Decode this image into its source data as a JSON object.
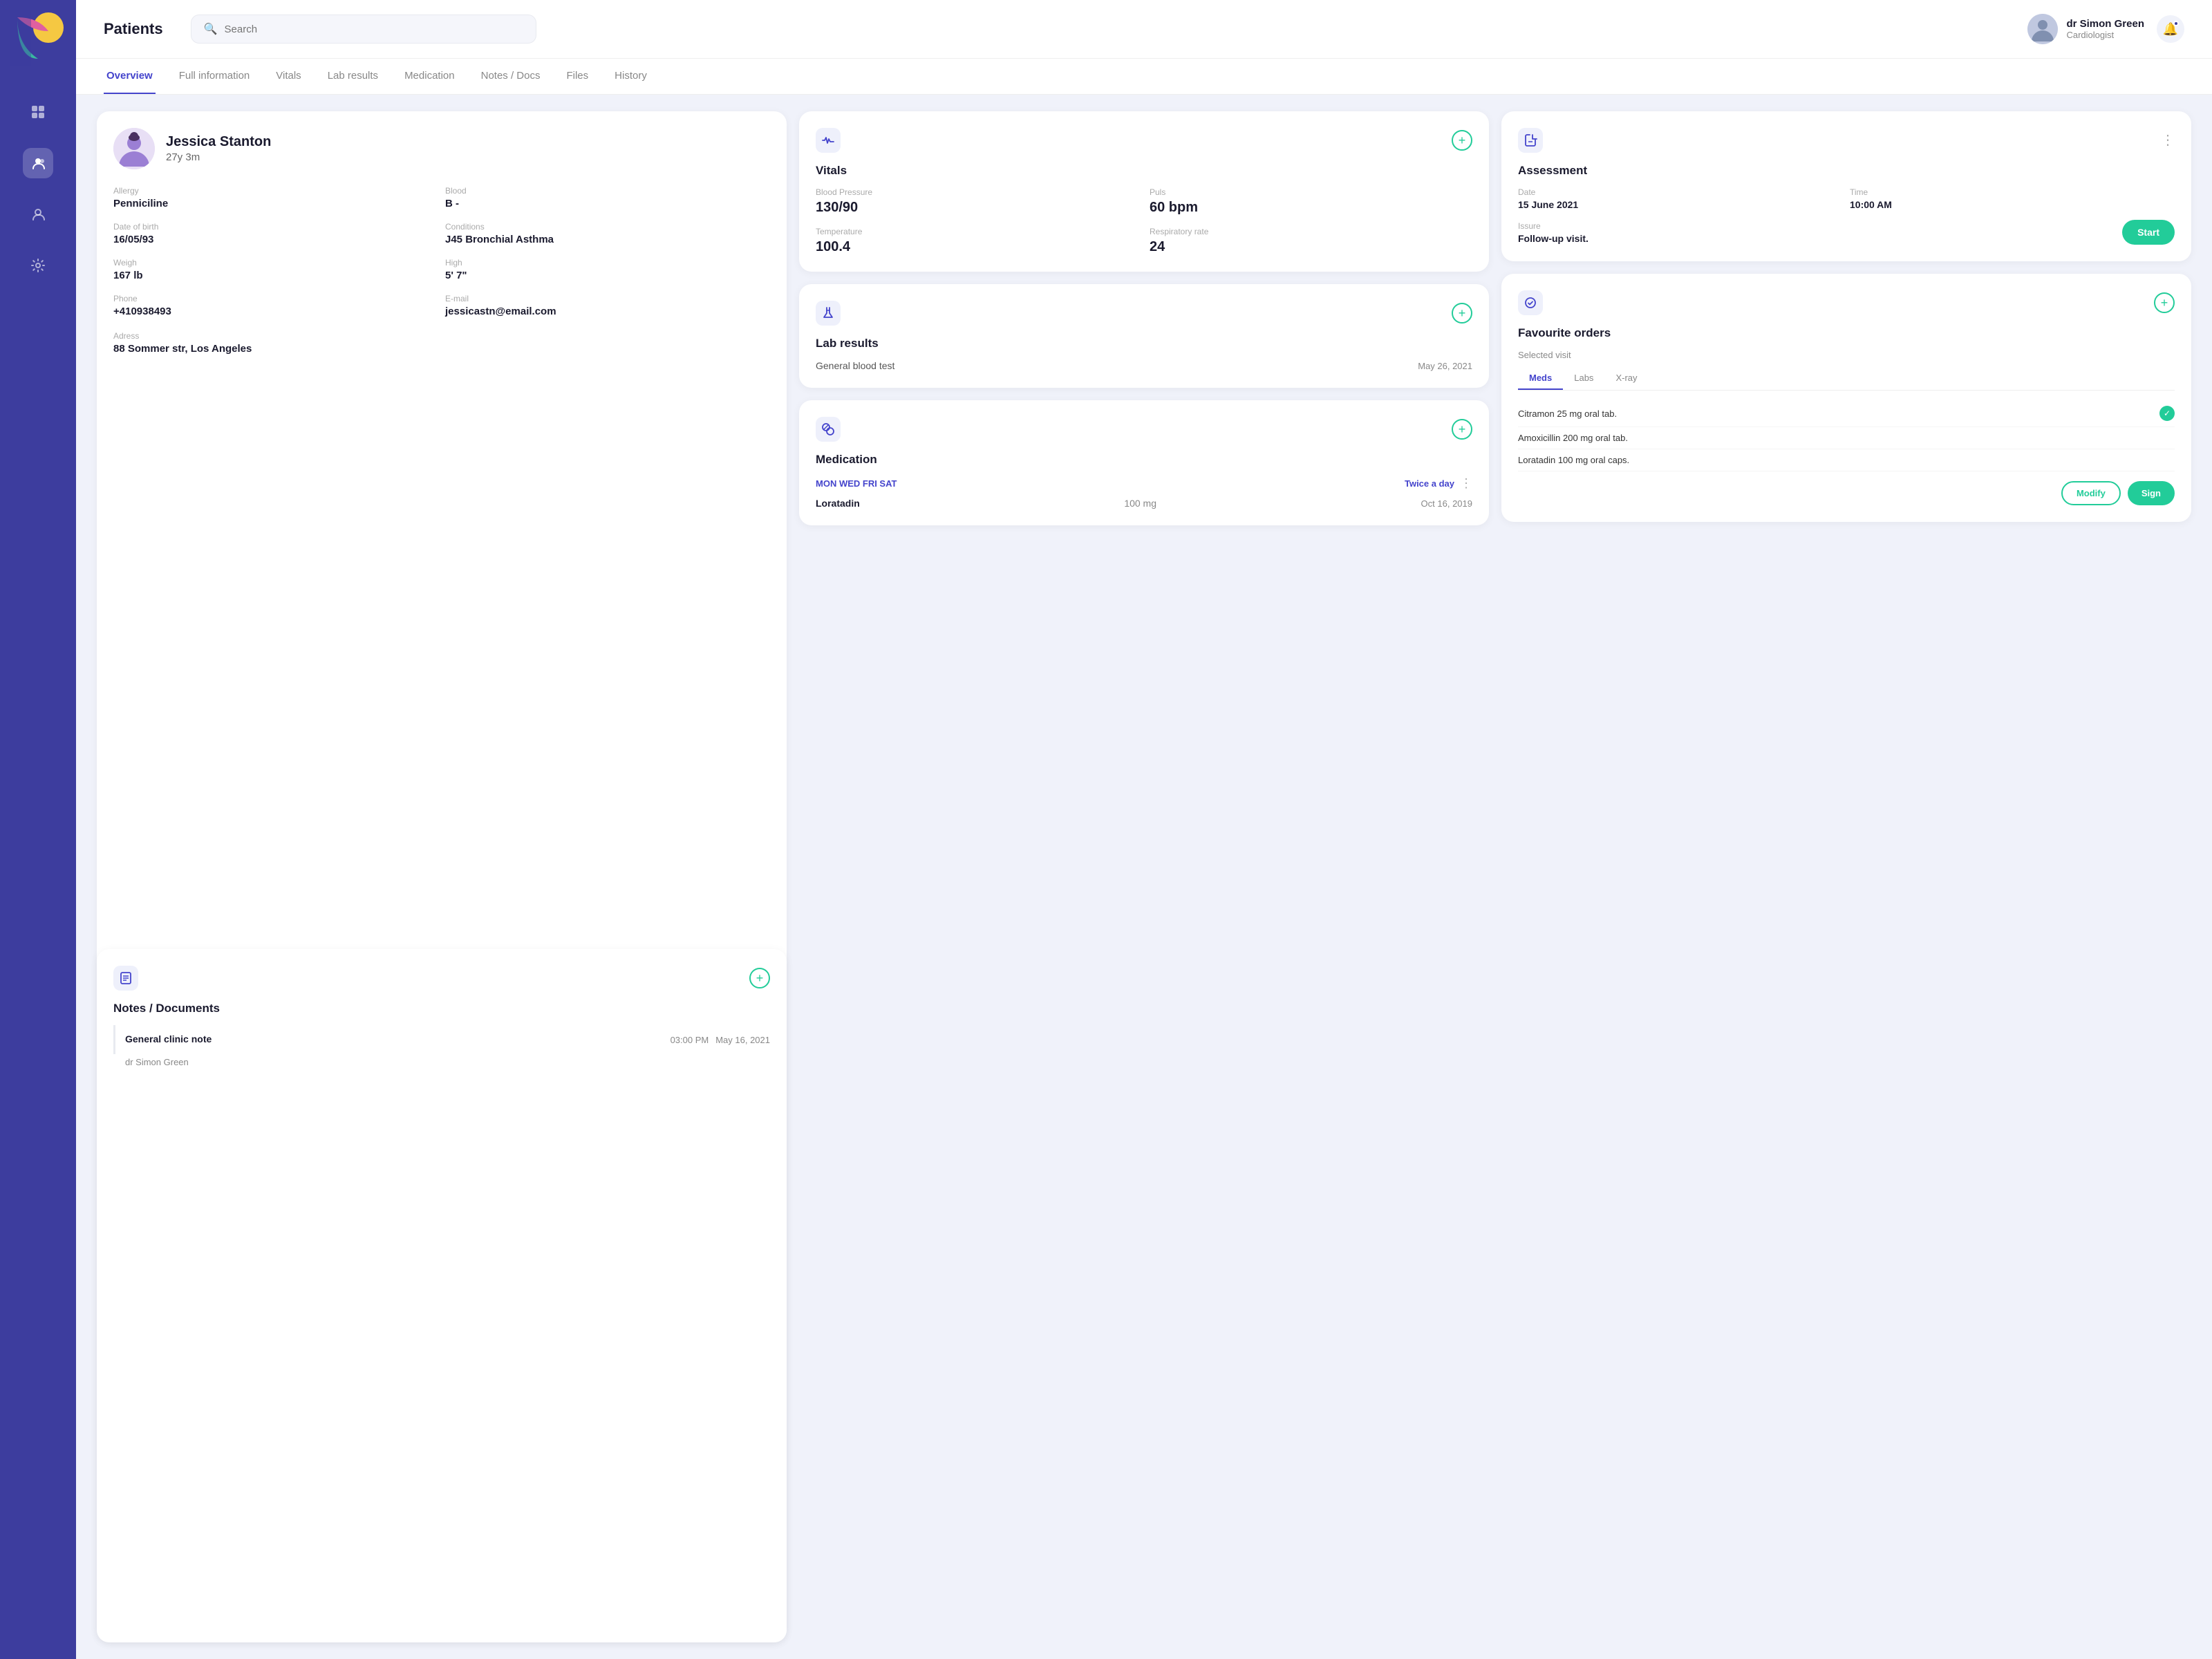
{
  "app": {
    "title": "Patients"
  },
  "header": {
    "search_placeholder": "Search",
    "doctor_name": "dr Simon Green",
    "doctor_role": "Cardiologist"
  },
  "tabs": [
    {
      "id": "overview",
      "label": "Overview",
      "active": true
    },
    {
      "id": "full-info",
      "label": "Full information",
      "active": false
    },
    {
      "id": "vitals",
      "label": "Vitals",
      "active": false
    },
    {
      "id": "lab-results",
      "label": "Lab results",
      "active": false
    },
    {
      "id": "medication",
      "label": "Medication",
      "active": false
    },
    {
      "id": "notes-docs",
      "label": "Notes / Docs",
      "active": false
    },
    {
      "id": "files",
      "label": "Files",
      "active": false
    },
    {
      "id": "history",
      "label": "History",
      "active": false
    }
  ],
  "patient": {
    "name": "Jessica Stanton",
    "age": "27y 3m",
    "allergy_label": "Allergy",
    "allergy": "Penniciline",
    "blood_label": "Blood",
    "blood": "B -",
    "dob_label": "Date of birth",
    "dob": "16/05/93",
    "conditions_label": "Conditions",
    "conditions": "J45 Bronchial Asthma",
    "weight_label": "Weigh",
    "weight": "167 lb",
    "height_label": "High",
    "height": "5' 7\"",
    "phone_label": "Phone",
    "phone": "+410938493",
    "email_label": "E-mail",
    "email": "jessicastn@email.com",
    "address_label": "Adress",
    "address": "88 Sommer str, Los Angeles"
  },
  "vitals": {
    "title": "Vitals",
    "bp_label": "Blood Pressure",
    "bp": "130/90",
    "puls_label": "Puls",
    "puls": "60 bpm",
    "temp_label": "Temperature",
    "temp": "100.4",
    "resp_label": "Respiratory rate",
    "resp": "24"
  },
  "assessment": {
    "title": "Assessment",
    "date_label": "Date",
    "date": "15 June 2021",
    "time_label": "Time",
    "time": "10:00 AM",
    "issue_label": "Issure",
    "issue": "Follow-up visit.",
    "start_btn": "Start"
  },
  "notes": {
    "title": "Notes / Documents",
    "entry_title": "General clinic note",
    "entry_time": "03:00 PM",
    "entry_date": "May 16, 2021",
    "entry_doctor": "dr Simon Green"
  },
  "lab": {
    "title": "Lab results",
    "entry_name": "General blood test",
    "entry_date": "May 26, 2021"
  },
  "medication": {
    "title": "Medication",
    "days": "MON  WED  FRI  SAT",
    "freq": "Twice a day",
    "med_name": "Loratadin",
    "med_dose": "100 mg",
    "med_date": "Oct 16, 2019"
  },
  "favourite_orders": {
    "title": "Favourite orders",
    "subtitle": "Selected visit",
    "tabs": [
      "Meds",
      "Labs",
      "X-ray"
    ],
    "active_tab": "Meds",
    "items": [
      {
        "name": "Citramon 25 mg oral tab.",
        "checked": true
      },
      {
        "name": "Amoxicillin 200 mg oral tab.",
        "checked": false
      },
      {
        "name": "Loratadin 100 mg oral caps.",
        "checked": false
      }
    ],
    "modify_btn": "Modify",
    "sign_btn": "Sign"
  },
  "sidebar": {
    "nav_items": [
      {
        "id": "grid",
        "icon": "⊞",
        "active": false
      },
      {
        "id": "users",
        "icon": "👤",
        "active": true
      },
      {
        "id": "person",
        "icon": "🧑",
        "active": false
      },
      {
        "id": "settings",
        "icon": "⚙",
        "active": false
      }
    ]
  }
}
